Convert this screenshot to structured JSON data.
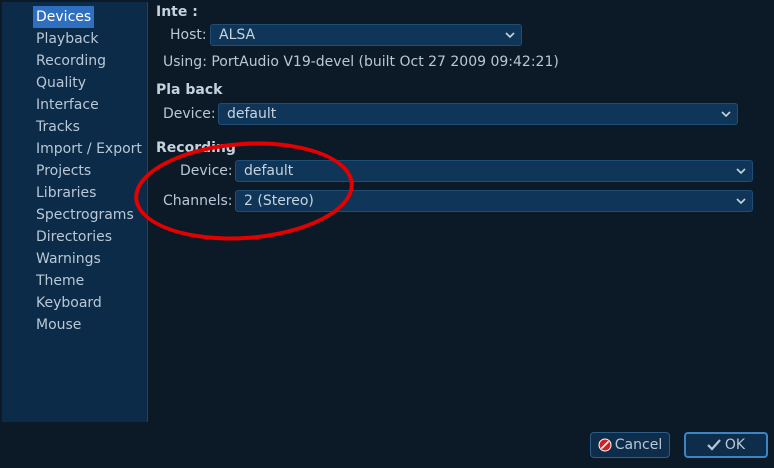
{
  "sidebar": {
    "items": [
      {
        "label": "Devices",
        "selected": true
      },
      {
        "label": "Playback"
      },
      {
        "label": "Recording"
      },
      {
        "label": "Quality"
      },
      {
        "label": "Interface"
      },
      {
        "label": "Tracks"
      },
      {
        "label": "Import / Export"
      },
      {
        "label": "Projects"
      },
      {
        "label": "Libraries"
      },
      {
        "label": "Spectrograms"
      },
      {
        "label": "Directories"
      },
      {
        "label": "Warnings"
      },
      {
        "label": "Theme"
      },
      {
        "label": "Keyboard"
      },
      {
        "label": "Mouse"
      }
    ]
  },
  "interface_group": {
    "title": "Inte    :",
    "host_label": "Host:",
    "host_value": "ALSA",
    "using_text": "Using:  PortAudio V19-devel (built Oct 27 2009 09:42:21)"
  },
  "playback_group": {
    "title": "Pla  back",
    "device_label": "Device:",
    "device_value": "default"
  },
  "recording_group": {
    "title": "Recording",
    "device_label": "Device:",
    "device_value": "default",
    "channels_label": "Channels:",
    "channels_value": "2 (Stereo)"
  },
  "buttons": {
    "cancel_label": "Cancel",
    "ok_label": "OK"
  },
  "colors": {
    "background": "#0b1a26",
    "sidebar": "#0c2b48",
    "selection": "#2f6fbf",
    "annotation": "#e40000"
  }
}
